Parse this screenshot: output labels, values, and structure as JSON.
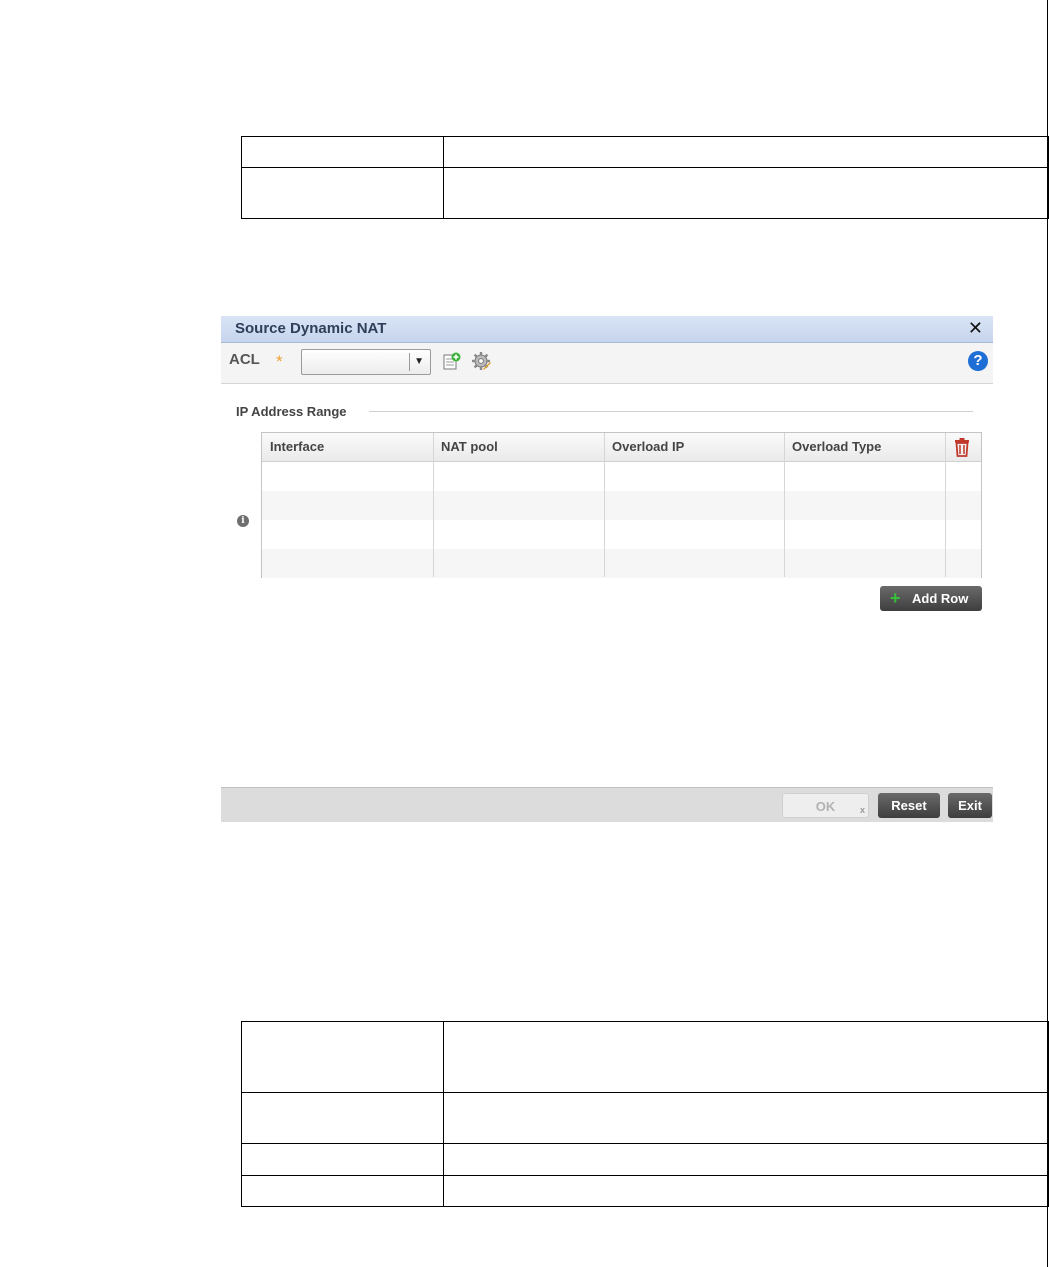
{
  "dialog": {
    "title": "Source Dynamic NAT",
    "close_icon": "close-icon",
    "acl_label": "ACL",
    "required_marker": "*",
    "acl_selected": "",
    "help_glyph": "?",
    "section_title": "IP Address Range",
    "info_glyph": "i",
    "columns": [
      "Interface",
      "NAT pool",
      "Overload IP",
      "Overload Type"
    ],
    "rows": [
      [
        "",
        "",
        "",
        ""
      ],
      [
        "",
        "",
        "",
        ""
      ],
      [
        "",
        "",
        "",
        ""
      ],
      [
        "",
        "",
        "",
        ""
      ]
    ],
    "add_row_label": "Add Row",
    "add_row_glyph": "+",
    "footer": {
      "ok_label": "OK",
      "ok_mark": "x",
      "reset_label": "Reset",
      "exit_label": "Exit"
    }
  },
  "colors": {
    "titlebar": "#c6d5ee",
    "required": "#f0a030",
    "help": "#1d6fd6",
    "delete": "#c0392b",
    "add": "#38c038"
  }
}
